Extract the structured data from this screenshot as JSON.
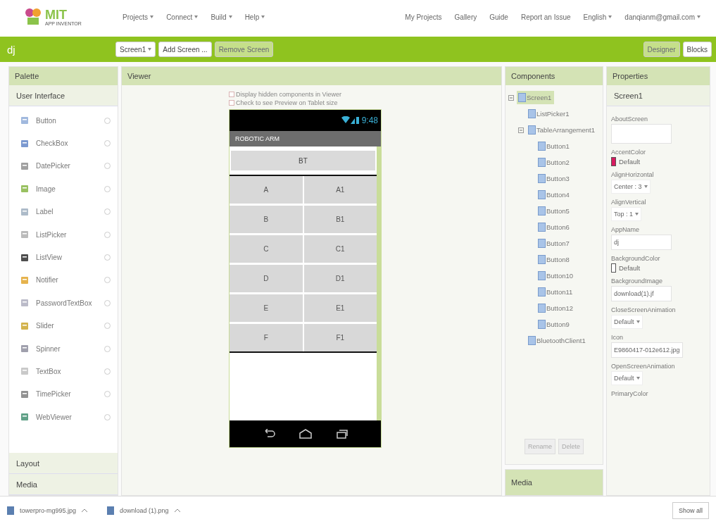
{
  "header": {
    "logo": {
      "title": "MIT",
      "subtitle": "APP INVENTOR"
    },
    "menus": [
      {
        "label": "Projects"
      },
      {
        "label": "Connect"
      },
      {
        "label": "Build"
      },
      {
        "label": "Help"
      }
    ],
    "links": [
      {
        "label": "My Projects",
        "dropdown": false
      },
      {
        "label": "Gallery",
        "dropdown": false
      },
      {
        "label": "Guide",
        "dropdown": false
      },
      {
        "label": "Report an Issue",
        "dropdown": false
      },
      {
        "label": "English",
        "dropdown": true
      },
      {
        "label": "danqianm@gmail.com",
        "dropdown": true
      }
    ]
  },
  "toolbar": {
    "project": "dj",
    "buttons": [
      {
        "label": "Screen1",
        "dropdown": true,
        "disabled": false
      },
      {
        "label": "Add Screen ...",
        "dropdown": false,
        "disabled": false
      },
      {
        "label": "Remove Screen",
        "dropdown": false,
        "disabled": true
      }
    ],
    "views": [
      {
        "label": "Designer",
        "selected": true
      },
      {
        "label": "Blocks",
        "selected": false
      }
    ]
  },
  "palette": {
    "title": "Palette",
    "sections": [
      {
        "label": "User Interface",
        "expanded": true,
        "items": [
          {
            "label": "Button"
          },
          {
            "label": "CheckBox"
          },
          {
            "label": "DatePicker"
          },
          {
            "label": "Image"
          },
          {
            "label": "Label"
          },
          {
            "label": "ListPicker"
          },
          {
            "label": "ListView"
          },
          {
            "label": "Notifier"
          },
          {
            "label": "PasswordTextBox"
          },
          {
            "label": "Slider"
          },
          {
            "label": "Spinner"
          },
          {
            "label": "TextBox"
          },
          {
            "label": "TimePicker"
          },
          {
            "label": "WebViewer"
          }
        ]
      },
      {
        "label": "Layout",
        "expanded": false
      },
      {
        "label": "Media",
        "expanded": false
      }
    ]
  },
  "viewer": {
    "title": "Viewer",
    "options": [
      {
        "label": "Display hidden components in Viewer",
        "checked": false
      },
      {
        "label": "Check to see Preview on Tablet size",
        "checked": false
      }
    ],
    "phone": {
      "time": "9:48",
      "title": "ROBOTIC ARM",
      "top_button": "BT",
      "rows": [
        [
          "A",
          "A1"
        ],
        [
          "B",
          "B1"
        ],
        [
          "C",
          "C1"
        ],
        [
          "D",
          "D1"
        ],
        [
          "E",
          "E1"
        ],
        [
          "F",
          "F1"
        ]
      ]
    }
  },
  "components": {
    "title": "Components",
    "tree": [
      {
        "label": "Screen1",
        "selected": true,
        "expanded": true,
        "children": [
          {
            "label": "ListPicker1",
            "selected": false
          },
          {
            "label": "TableArrangement1",
            "selected": false,
            "expanded": true,
            "children": [
              {
                "label": "Button1",
                "selected": false
              },
              {
                "label": "Button2",
                "selected": false
              },
              {
                "label": "Button3",
                "selected": false
              },
              {
                "label": "Button4",
                "selected": false
              },
              {
                "label": "Button5",
                "selected": false
              },
              {
                "label": "Button6",
                "selected": false
              },
              {
                "label": "Button7",
                "selected": false
              },
              {
                "label": "Button8",
                "selected": false
              },
              {
                "label": "Button10",
                "selected": false
              },
              {
                "label": "Button11",
                "selected": false
              },
              {
                "label": "Button12",
                "selected": false
              },
              {
                "label": "Button9",
                "selected": false
              }
            ]
          },
          {
            "label": "BluetoothClient1",
            "selected": false
          }
        ]
      }
    ],
    "buttons": [
      {
        "label": "Rename",
        "disabled": true
      },
      {
        "label": "Delete",
        "disabled": true
      }
    ],
    "media_title": "Media"
  },
  "properties": {
    "title": "Properties",
    "subject": "Screen1",
    "items": [
      {
        "label": "AboutScreen",
        "kind": "textarea"
      },
      {
        "label": "AccentColor",
        "kind": "color",
        "value": "Default",
        "color": "#d81b60"
      },
      {
        "label": "AlignHorizontal",
        "kind": "dropdown",
        "value": "Center : 3"
      },
      {
        "label": "AlignVertical",
        "kind": "dropdown",
        "value": "Top : 1"
      },
      {
        "label": "AppName",
        "kind": "text",
        "value": "dj"
      },
      {
        "label": "BackgroundColor",
        "kind": "color",
        "value": "Default",
        "color": "#ffffff"
      },
      {
        "label": "BackgroundImage",
        "kind": "text",
        "value": "download(1).jf"
      },
      {
        "label": "CloseScreenAnimation",
        "kind": "dropdown",
        "value": "Default"
      },
      {
        "label": "Icon",
        "kind": "text",
        "value": "E9860417-012e612.jpg"
      },
      {
        "label": "OpenScreenAnimation",
        "kind": "dropdown",
        "value": "Default"
      },
      {
        "label": "PrimaryColor",
        "kind": "label"
      }
    ]
  },
  "downloads": {
    "files": [
      {
        "name": "towerpro-mg995.jpg"
      },
      {
        "name": "download (1).png"
      }
    ],
    "show_all": "Show all"
  }
}
